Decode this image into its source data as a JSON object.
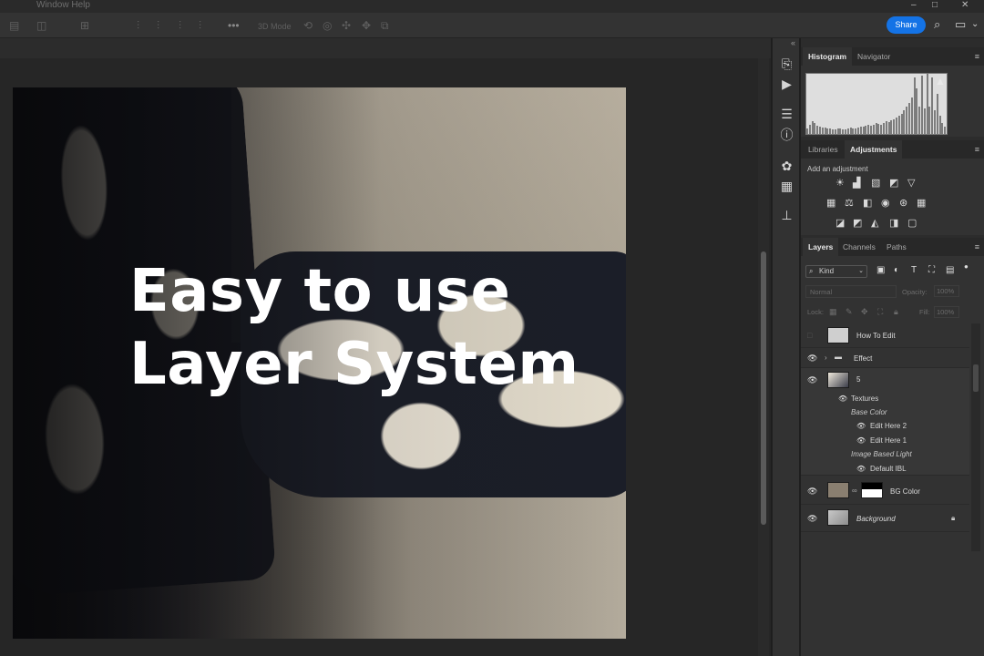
{
  "menu": {
    "items_fragment": "Window  Help"
  },
  "window_controls": [
    "–",
    "□",
    "✕"
  ],
  "options_bar": {
    "mode_3d": "3D Mode",
    "share_label": "Share"
  },
  "canvas": {
    "headline_line1": "Easy to use",
    "headline_line2": "Layer System"
  },
  "histogram_panel": {
    "tabs": [
      "Histogram",
      "Navigator"
    ],
    "warning_icon": "warning-icon"
  },
  "adjustments_panel": {
    "tabs": [
      "Libraries",
      "Adjustments"
    ],
    "add_label": "Add an adjustment"
  },
  "layers_panel": {
    "tabs": [
      "Layers",
      "Channels",
      "Paths"
    ],
    "kind_label": "Kind",
    "blend_mode": "Normal",
    "opacity_label": "Opacity:",
    "opacity_value": "100%",
    "lock_label": "Lock:",
    "fill_label": "Fill:",
    "fill_value": "100%",
    "layers": [
      {
        "name": "How To Edit"
      },
      {
        "name": "Effect"
      },
      {
        "name": "5"
      },
      {
        "name": "BG Color"
      },
      {
        "name": "Background"
      }
    ],
    "smart_object": {
      "textures": "Textures",
      "base_color": "Base Color",
      "edit2": "Edit Here 2",
      "edit1": "Edit Here 1",
      "ibl": "Image Based Light",
      "default_ibl": "Default IBL"
    }
  },
  "colors": {
    "accent": "#1473e6",
    "panel_bg": "#323232",
    "canvas_bg": "#262626"
  }
}
